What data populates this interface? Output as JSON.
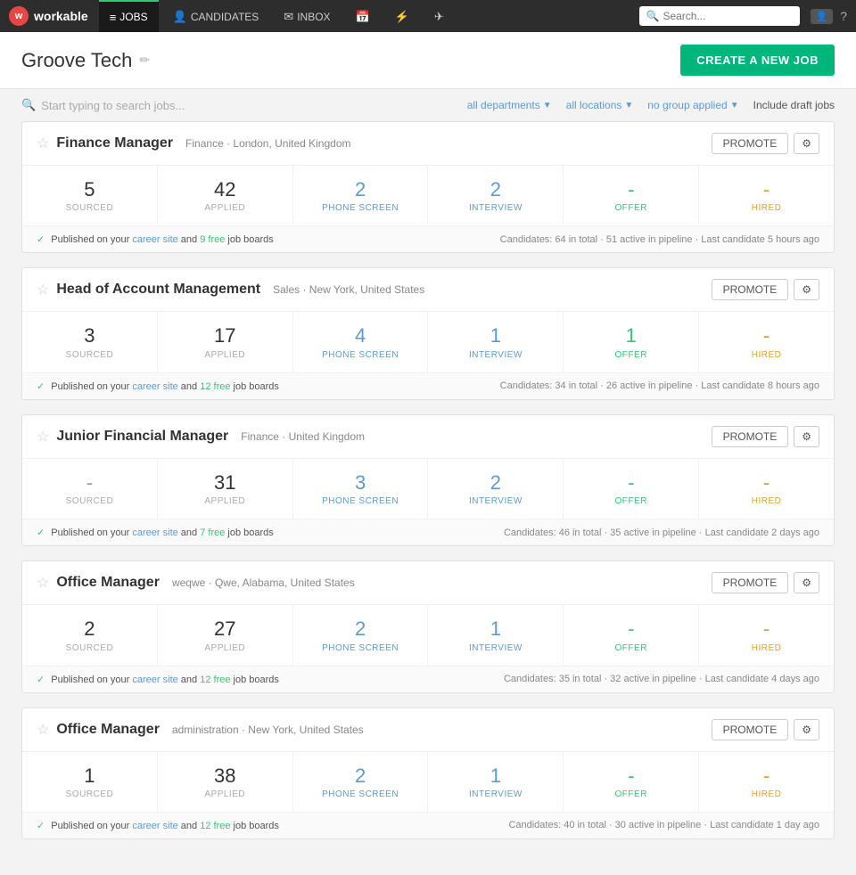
{
  "nav": {
    "logo_text": "workable",
    "tabs": [
      {
        "label": "JOBS",
        "icon": "📋",
        "active": true
      },
      {
        "label": "CANDIDATES",
        "icon": "👤",
        "active": false
      },
      {
        "label": "INBOX",
        "icon": "✉",
        "active": false
      },
      {
        "label": "",
        "icon": "📅",
        "active": false
      },
      {
        "label": "",
        "icon": "🔗",
        "active": false
      },
      {
        "label": "",
        "icon": "✈",
        "active": false
      }
    ],
    "search_placeholder": "Search...",
    "help_icon": "?"
  },
  "header": {
    "title": "Groove Tech",
    "edit_icon": "✏",
    "create_btn": "CREATE A NEW JOB"
  },
  "filters": {
    "search_placeholder": "Start typing to search jobs...",
    "departments": "all departments",
    "locations": "all locations",
    "group": "no group applied",
    "draft_link": "Include draft jobs"
  },
  "jobs": [
    {
      "id": "finance-manager",
      "title": "Finance Manager",
      "department": "Finance",
      "location": "London, United Kingdom",
      "metrics": [
        {
          "value": "5",
          "label": "SOURCED",
          "type": "normal"
        },
        {
          "value": "42",
          "label": "APPLIED",
          "type": "normal"
        },
        {
          "value": "2",
          "label": "PHONE SCREEN",
          "type": "linked"
        },
        {
          "value": "2",
          "label": "INTERVIEW",
          "type": "linked"
        },
        {
          "value": "-",
          "label": "OFFER",
          "type": "offer"
        },
        {
          "value": "-",
          "label": "HIRED",
          "type": "hired"
        }
      ],
      "published": "Published on your",
      "career_site": "career site",
      "free_count": "9 free",
      "job_boards": "job boards",
      "candidates_total": "64",
      "candidates_active": "51",
      "last_candidate": "5 hours ago"
    },
    {
      "id": "head-of-account-management",
      "title": "Head of Account Management",
      "department": "Sales",
      "location": "New York, United States",
      "metrics": [
        {
          "value": "3",
          "label": "SOURCED",
          "type": "normal"
        },
        {
          "value": "17",
          "label": "APPLIED",
          "type": "normal"
        },
        {
          "value": "4",
          "label": "PHONE SCREEN",
          "type": "linked"
        },
        {
          "value": "1",
          "label": "INTERVIEW",
          "type": "linked"
        },
        {
          "value": "1",
          "label": "OFFER",
          "type": "offer"
        },
        {
          "value": "-",
          "label": "HIRED",
          "type": "hired"
        }
      ],
      "published": "Published on your",
      "career_site": "career site",
      "free_count": "12 free",
      "job_boards": "job boards",
      "candidates_total": "34",
      "candidates_active": "26",
      "last_candidate": "8 hours ago"
    },
    {
      "id": "junior-financial-manager",
      "title": "Junior Financial Manager",
      "department": "Finance",
      "location": "United Kingdom",
      "metrics": [
        {
          "value": "-",
          "label": "SOURCED",
          "type": "dash"
        },
        {
          "value": "31",
          "label": "APPLIED",
          "type": "normal"
        },
        {
          "value": "3",
          "label": "PHONE SCREEN",
          "type": "linked"
        },
        {
          "value": "2",
          "label": "INTERVIEW",
          "type": "linked"
        },
        {
          "value": "-",
          "label": "OFFER",
          "type": "offer"
        },
        {
          "value": "-",
          "label": "HIRED",
          "type": "hired"
        }
      ],
      "published": "Published on your",
      "career_site": "career site",
      "free_count": "7 free",
      "job_boards": "job boards",
      "candidates_total": "46",
      "candidates_active": "35",
      "last_candidate": "2 days ago"
    },
    {
      "id": "office-manager-weqwe",
      "title": "Office Manager",
      "department": "weqwe",
      "location": "Qwe, Alabama, United States",
      "metrics": [
        {
          "value": "2",
          "label": "SOURCED",
          "type": "normal"
        },
        {
          "value": "27",
          "label": "APPLIED",
          "type": "normal"
        },
        {
          "value": "2",
          "label": "PHONE SCREEN",
          "type": "linked"
        },
        {
          "value": "1",
          "label": "INTERVIEW",
          "type": "linked"
        },
        {
          "value": "-",
          "label": "OFFER",
          "type": "offer"
        },
        {
          "value": "-",
          "label": "HIRED",
          "type": "hired"
        }
      ],
      "published": "Published on your",
      "career_site": "career site",
      "free_count": "12 free",
      "job_boards": "job boards",
      "candidates_total": "35",
      "candidates_active": "32",
      "last_candidate": "4 days ago"
    },
    {
      "id": "office-manager-admin",
      "title": "Office Manager",
      "department": "administration",
      "location": "New York, United States",
      "metrics": [
        {
          "value": "1",
          "label": "SOURCED",
          "type": "normal"
        },
        {
          "value": "38",
          "label": "APPLIED",
          "type": "normal"
        },
        {
          "value": "2",
          "label": "PHONE SCREEN",
          "type": "linked"
        },
        {
          "value": "1",
          "label": "INTERVIEW",
          "type": "linked"
        },
        {
          "value": "-",
          "label": "OFFER",
          "type": "offer"
        },
        {
          "value": "-",
          "label": "HIRED",
          "type": "hired"
        }
      ],
      "published": "Published on your",
      "career_site": "career site",
      "free_count": "12 free",
      "job_boards": "job boards",
      "candidates_total": "40",
      "candidates_active": "30",
      "last_candidate": "1 day ago"
    }
  ],
  "labels": {
    "promote": "PROMOTE",
    "settings_icon": "⚙",
    "star": "☆",
    "check": "✓",
    "and": "and",
    "candidates": "Candidates:",
    "in_total": "in total",
    "active_in_pipeline": "active in pipeline",
    "last_candidate": "Last candidate"
  }
}
